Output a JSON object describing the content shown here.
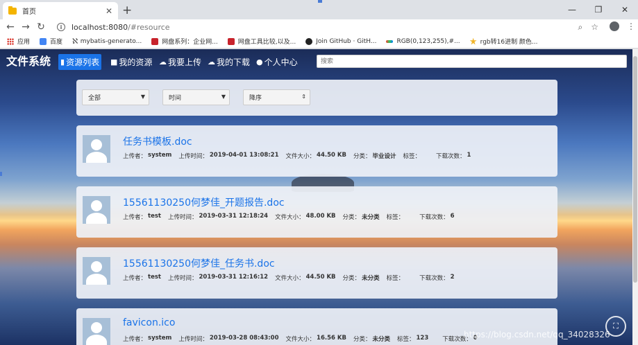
{
  "browser": {
    "tab_title": "首页",
    "url_host": "localhost:8080",
    "url_path": "/#resource",
    "bookmarks": [
      {
        "label": "应用",
        "icon": "apps-icon"
      },
      {
        "label": "百度",
        "icon": "baidu-icon"
      },
      {
        "label": "mybatis-generato...",
        "icon": "mybatis-icon"
      },
      {
        "label": "网盘系列：企业网...",
        "icon": "csdn-icon"
      },
      {
        "label": "网盘工具比较,以及...",
        "icon": "csdn-icon"
      },
      {
        "label": "Join GitHub · GitH...",
        "icon": "github-icon"
      },
      {
        "label": "RGB(0,123,255),#...",
        "icon": "rgb-icon"
      },
      {
        "label": "rgb转16进制 颜色...",
        "icon": "star-icon"
      }
    ]
  },
  "app": {
    "brand": "文件系统",
    "nav": [
      {
        "label": "资源列表",
        "icon": "file-icon",
        "glyph": "▮",
        "active": true
      },
      {
        "label": "我的资源",
        "icon": "lock-icon",
        "glyph": "🔒",
        "active": false
      },
      {
        "label": "我要上传",
        "icon": "upload-icon",
        "glyph": "☁",
        "active": false
      },
      {
        "label": "我的下载",
        "icon": "download-icon",
        "glyph": "☁",
        "active": false
      },
      {
        "label": "个人中心",
        "icon": "user-icon",
        "glyph": "👤",
        "active": false
      }
    ],
    "search_placeholder": "搜索"
  },
  "filters": {
    "category": "全部",
    "sort_field": "时间",
    "sort_order": "降序"
  },
  "labels": {
    "uploader": "上传者：",
    "upload_time": "上传时间：",
    "file_size": "文件大小：",
    "category": "分类：",
    "tags": "标签：",
    "downloads": "下载次数："
  },
  "files": [
    {
      "name": "任务书模板.doc",
      "uploader": "system",
      "time": "2019-04-01 13:08:21",
      "size": "44.50 KB",
      "category": "毕业设计",
      "tags": "",
      "downloads": "1"
    },
    {
      "name": "15561130250何梦佳_开题报告.doc",
      "uploader": "test",
      "time": "2019-03-31 12:18:24",
      "size": "48.00 KB",
      "category": "未分类",
      "tags": "",
      "downloads": "6"
    },
    {
      "name": "15561130250何梦佳_任务书.doc",
      "uploader": "test",
      "time": "2019-03-31 12:16:12",
      "size": "44.50 KB",
      "category": "未分类",
      "tags": "",
      "downloads": "2"
    },
    {
      "name": "favicon.ico",
      "uploader": "system",
      "time": "2019-03-28 08:43:00",
      "size": "16.56 KB",
      "category": "未分类",
      "tags": "123",
      "downloads": "0"
    }
  ],
  "watermark": "https://blog.csdn.net/qq_34028326"
}
